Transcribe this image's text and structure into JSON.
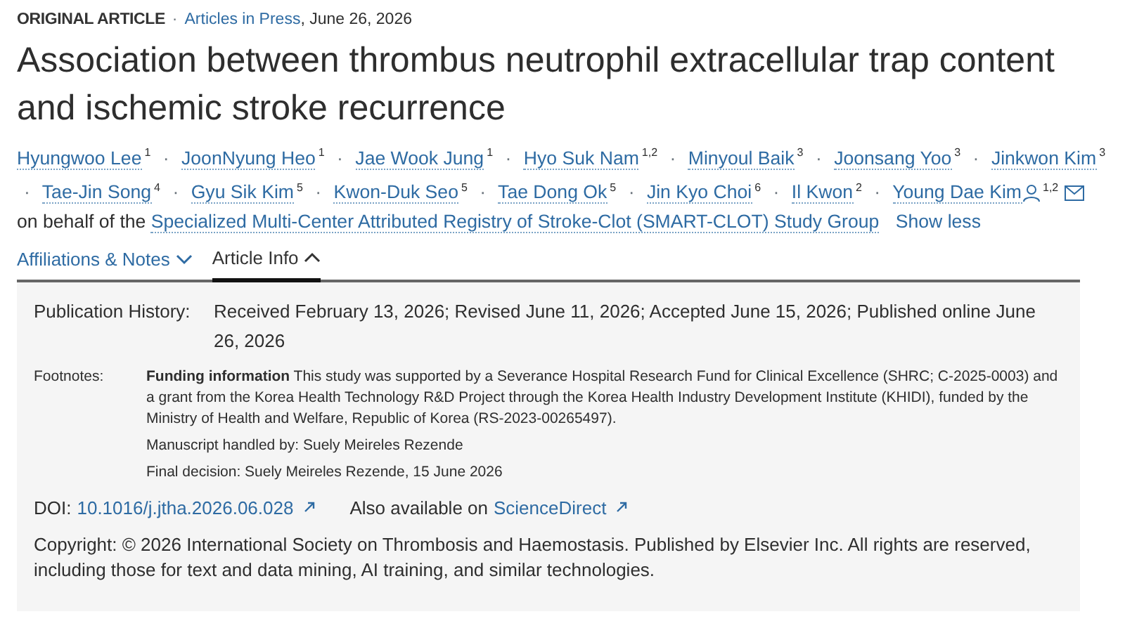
{
  "header": {
    "article_type": "ORIGINAL ARTICLE",
    "separator": "·",
    "section_link": "Articles in Press",
    "date": ", June 26, 2026"
  },
  "title": "Association between thrombus neutrophil extracellular trap content and ischemic stroke recurrence",
  "authors": [
    {
      "name": "Hyungwoo Lee",
      "sup": "1"
    },
    {
      "name": "JoonNyung Heo",
      "sup": "1"
    },
    {
      "name": "Jae Wook Jung",
      "sup": "1"
    },
    {
      "name": "Hyo Suk Nam",
      "sup": "1,2"
    },
    {
      "name": "Minyoul Baik",
      "sup": "3"
    },
    {
      "name": "Joonsang Yoo",
      "sup": "3"
    },
    {
      "name": "Jinkwon Kim",
      "sup": "3"
    },
    {
      "name": "Tae-Jin Song",
      "sup": "4"
    },
    {
      "name": "Gyu Sik Kim",
      "sup": "5"
    },
    {
      "name": "Kwon-Duk Seo",
      "sup": "5"
    },
    {
      "name": "Tae Dong Ok",
      "sup": "5"
    },
    {
      "name": "Jin Kyo Choi",
      "sup": "6"
    },
    {
      "name": "Il Kwon",
      "sup": "2"
    },
    {
      "name": "Young Dae Kim",
      "sup": "1,2",
      "corresponding": true,
      "email": true
    }
  ],
  "author_separator": "·",
  "on_behalf_text": "on behalf of the",
  "study_group": "Specialized Multi-Center Attributed Registry of Stroke-Clot (SMART-CLOT) Study Group",
  "show_less": "Show less",
  "tabs": [
    {
      "label": "Affiliations & Notes",
      "selected": false,
      "expanded": false
    },
    {
      "label": "Article Info",
      "selected": true,
      "expanded": true
    }
  ],
  "info": {
    "publication_history": {
      "label": "Publication History:",
      "value": "Received February 13, 2026; Revised June 11, 2026; Accepted June 15, 2026; Published online June 26, 2026"
    },
    "footnotes": {
      "label": "Footnotes:",
      "lines": [
        "**Funding information** This study was supported by a Severance Hospital Research Fund for Clinical Excellence (SHRC; C-2025-0003) and a grant from the Korea Health Technology R&D Project through the Korea Health Industry Development Institute (KHIDI), funded by the Ministry of Health and Welfare, Republic of Korea (RS-2023-00265497).",
        "Manuscript handled by: Suely Meireles Rezende",
        "Final decision: Suely Meireles Rezende, 15 June 2026"
      ]
    },
    "doi": {
      "label": "DOI:",
      "link": "10.1016/j.jtha.2026.06.028"
    },
    "also_available": {
      "text": "Also available on",
      "link": "ScienceDirect"
    },
    "copyright": "Copyright: © 2026 International Society on Thrombosis and Haemostasis. Published by Elsevier Inc. All rights are reserved, including those for text and data mining, AI training, and similar technologies."
  }
}
